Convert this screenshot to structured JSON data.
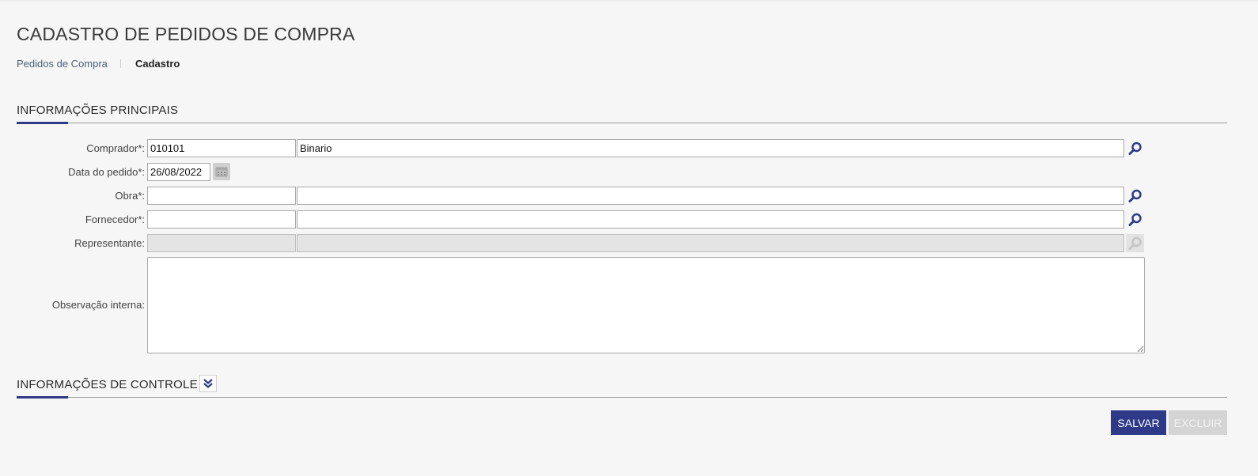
{
  "header": {
    "title": "CADASTRO DE PEDIDOS DE COMPRA",
    "breadcrumb": {
      "link": "Pedidos de Compra",
      "current": "Cadastro"
    }
  },
  "section_main": {
    "title": "INFORMAÇÕES PRINCIPAIS"
  },
  "form": {
    "comprador": {
      "label": "Comprador*:",
      "code": "010101",
      "name": "Binario"
    },
    "data_pedido": {
      "label": "Data do pedido*:",
      "value": "26/08/2022"
    },
    "obra": {
      "label": "Obra*:",
      "code": "",
      "name": ""
    },
    "fornecedor": {
      "label": "Fornecedor*:",
      "code": "",
      "name": ""
    },
    "representante": {
      "label": "Representante:",
      "code": "",
      "name": ""
    },
    "observacao": {
      "label": "Observação interna:",
      "value": ""
    }
  },
  "section_control": {
    "title": "INFORMAÇÕES DE CONTROLE"
  },
  "actions": {
    "save_label": "SALVAR",
    "delete_label": "EXCLUIR"
  },
  "colors": {
    "accent": "#2e3a87",
    "search_icon": "#2e3a87",
    "disabled": "#d4d4d4"
  },
  "icons": {
    "search": "magnifier-icon",
    "calendar": "calendar-icon",
    "expand": "double-chevron-down-icon"
  }
}
